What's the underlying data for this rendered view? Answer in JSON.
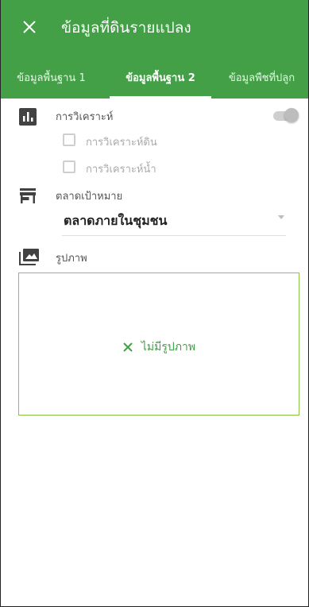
{
  "app": {
    "title": "ข้อมูลที่ดินรายแปลง",
    "close_icon": "close-icon"
  },
  "tabs": [
    {
      "label": "ข้อมูลพื้นฐาน 1",
      "active": false
    },
    {
      "label": "ข้อมูลพื้นฐาน 2",
      "active": true
    },
    {
      "label": "ข้อมูลพืชที่ปลูก",
      "active": false
    }
  ],
  "analysis": {
    "label": "การวิเคราะห์",
    "icon": "bar-chart-icon",
    "toggle_on": false,
    "options": [
      {
        "label": "การวิเคราะห์ดิน",
        "checked": false
      },
      {
        "label": "การวิเคราะห์น้ำ",
        "checked": false
      }
    ]
  },
  "market": {
    "label": "ตลาดเป้าหมาย",
    "icon": "store-icon",
    "value": "ตลาดภายในชุมชน"
  },
  "photos": {
    "label": "รูปภาพ",
    "icon": "photo-library-icon",
    "empty_text": "ไม่มีรูปภาพ"
  },
  "colors": {
    "primary": "#43a047",
    "box_border": "#8bc34a"
  }
}
